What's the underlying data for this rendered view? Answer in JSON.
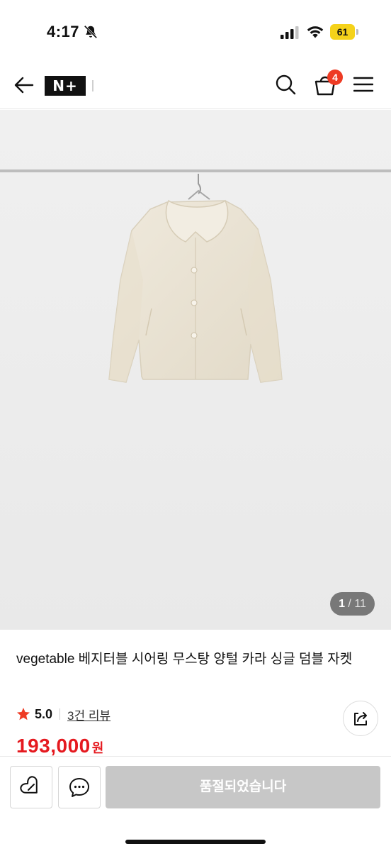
{
  "status_bar": {
    "time": "4:17",
    "battery": "61",
    "icons": [
      "bell-slash-icon",
      "cellular-signal-icon",
      "wifi-icon",
      "battery-icon"
    ]
  },
  "header": {
    "logo_text": "N+",
    "cart_count": "4",
    "icons": [
      "back-arrow-icon",
      "search-icon",
      "cart-icon",
      "hamburger-menu-icon"
    ]
  },
  "gallery": {
    "current": "1",
    "total": "11",
    "separator": "/ "
  },
  "product": {
    "title": "vegetable 베지터블 시어링 무스탕 양털 카라 싱글 덤블 자켓",
    "rating": "5.0",
    "review_link": "3건 리뷰",
    "price": "193,000",
    "price_unit": "원"
  },
  "actions": {
    "soldout_label": "품절되었습니다",
    "icons": [
      "wishlist-icon",
      "chat-icon",
      "share-icon"
    ]
  },
  "colors": {
    "accent_red": "#e5191f",
    "badge_red": "#ee3b24",
    "battery_yellow": "#f5d21a",
    "disabled_gray": "#c7c7c7"
  }
}
